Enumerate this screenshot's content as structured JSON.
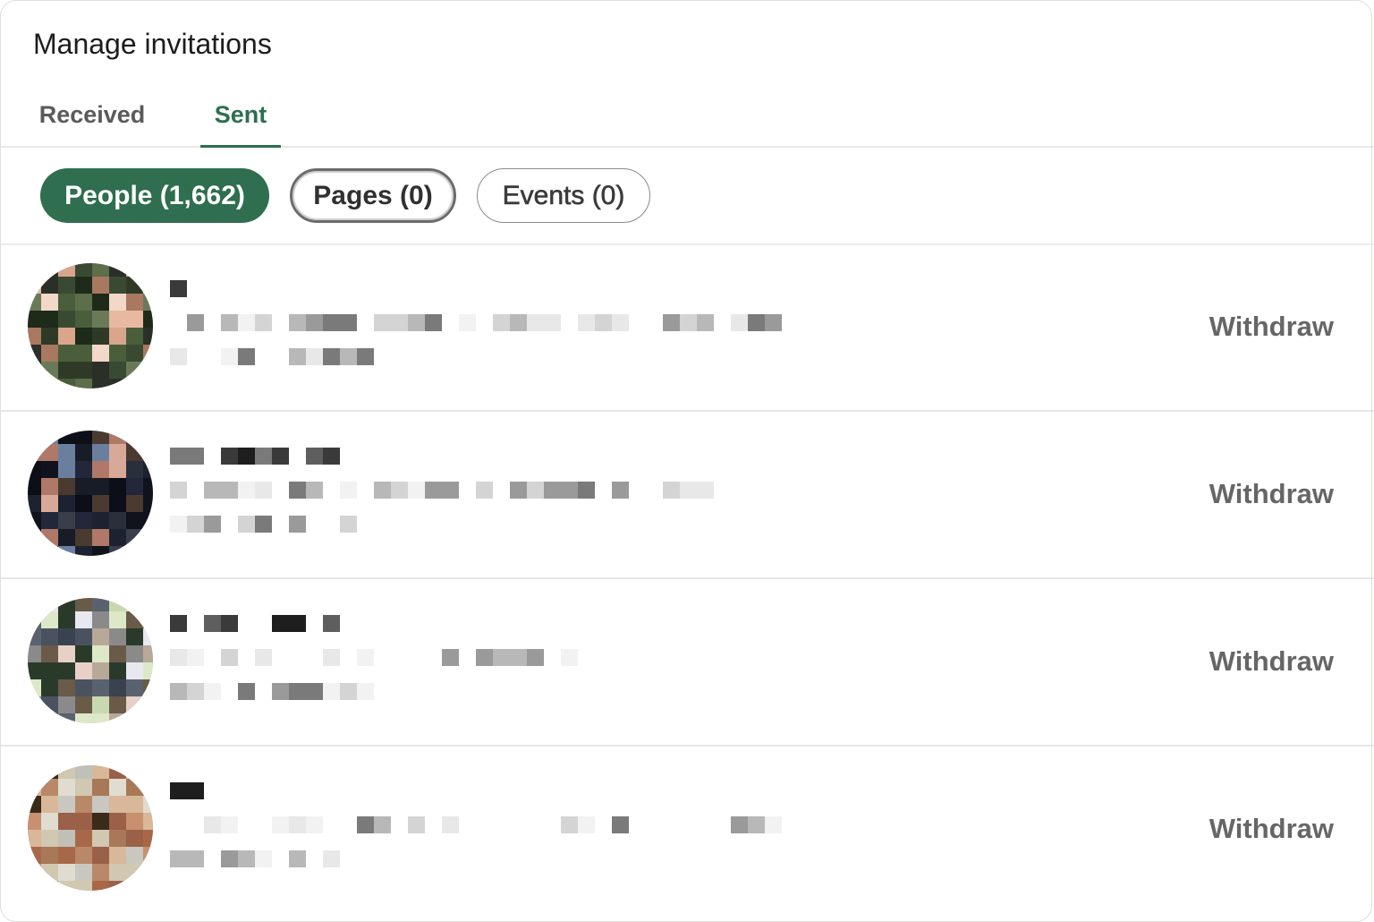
{
  "header": {
    "title": "Manage invitations"
  },
  "tabs": [
    {
      "label": "Received",
      "active": false
    },
    {
      "label": "Sent",
      "active": true
    }
  ],
  "filters": [
    {
      "label": "People (1,662)",
      "selected": true
    },
    {
      "label": "Pages (0)",
      "selected": false
    },
    {
      "label": "Events (0)",
      "selected": false
    }
  ],
  "invitations": [
    {
      "action_label": "Withdraw",
      "avatar_redacted": true,
      "details_redacted": true
    },
    {
      "action_label": "Withdraw",
      "avatar_redacted": true,
      "details_redacted": true
    },
    {
      "action_label": "Withdraw",
      "avatar_redacted": true,
      "details_redacted": true
    },
    {
      "action_label": "Withdraw",
      "avatar_redacted": true,
      "details_redacted": true
    }
  ],
  "colors": {
    "accent": "#2f6e4e",
    "tab_active": "#2d6f4f",
    "action_text": "#666666"
  }
}
